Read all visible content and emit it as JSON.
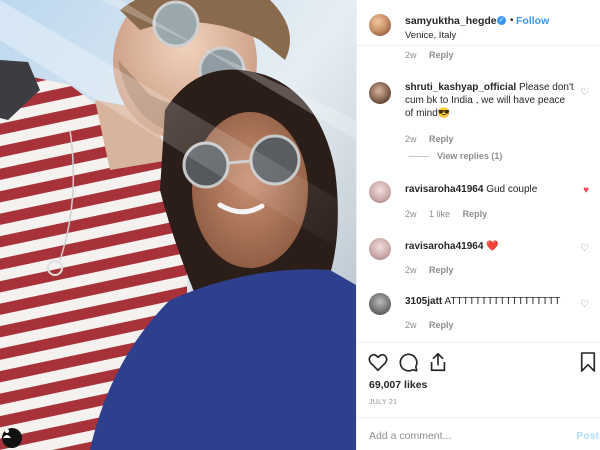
{
  "post": {
    "username": "samyuktha_hegde",
    "verified_badge": "✓",
    "follow_label": "Follow",
    "dot": "•",
    "location": "Venice, Italy",
    "more_label": "•••"
  },
  "comments": [
    {
      "meta_time": "2w",
      "reply_label": "Reply",
      "partial": true
    },
    {
      "username": "shruti_kashyap_official",
      "text": "Please don't cum bk to India , we will have peace of mind😎",
      "meta_time": "2w",
      "reply_label": "Reply",
      "view_replies": "View replies (1)",
      "liked": false
    },
    {
      "username": "ravisaroha41964",
      "text": "Gud couple",
      "meta_time": "2w",
      "meta_likes": "1 like",
      "reply_label": "Reply",
      "liked": true
    },
    {
      "username": "ravisaroha41964",
      "text": "❤️",
      "meta_time": "2w",
      "reply_label": "Reply",
      "liked": false
    },
    {
      "username": "3105jatt",
      "text": "ATTTTTTTTTTTTTTTTTT",
      "meta_time": "2w",
      "reply_label": "Reply",
      "liked": false
    }
  ],
  "icons": {
    "like": "heart-icon",
    "comment": "comment-bubble-icon",
    "share": "share-icon",
    "save": "bookmark-icon",
    "user_tag": "user-tag-icon",
    "more": "more-options-icon"
  },
  "likes_count": "69,007 likes",
  "date": "JULY 21",
  "add_comment": {
    "placeholder": "Add a comment...",
    "post_label": "Post"
  },
  "colors": {
    "accent": "#3897f0",
    "like_red": "#ed4956",
    "muted": "#8e8e8e",
    "post_disabled": "#b2dffc"
  }
}
